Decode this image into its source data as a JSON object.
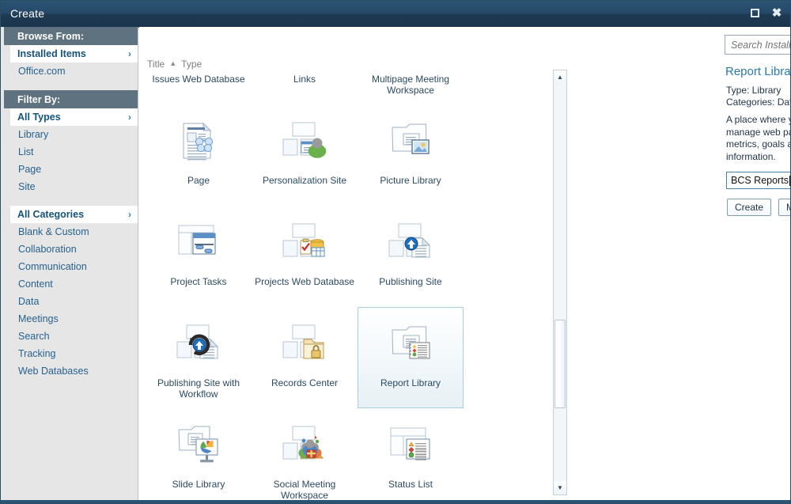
{
  "window": {
    "title": "Create",
    "maximize_label": "Restore",
    "close_label": "Close"
  },
  "sidebar": {
    "browse_from_header": "Browse From:",
    "browse_items": [
      {
        "label": "Installed Items",
        "selected": true,
        "chevron": "›"
      },
      {
        "label": "Office.com",
        "selected": false
      }
    ],
    "filter_by_header": "Filter By:",
    "type_items": [
      {
        "label": "All Types",
        "selected": true,
        "chevron": "›"
      },
      {
        "label": "Library",
        "selected": false
      },
      {
        "label": "List",
        "selected": false
      },
      {
        "label": "Page",
        "selected": false
      },
      {
        "label": "Site",
        "selected": false
      }
    ],
    "category_items": [
      {
        "label": "All Categories",
        "selected": true,
        "chevron": "›"
      },
      {
        "label": "Blank & Custom",
        "selected": false
      },
      {
        "label": "Collaboration",
        "selected": false
      },
      {
        "label": "Communication",
        "selected": false
      },
      {
        "label": "Content",
        "selected": false
      },
      {
        "label": "Data",
        "selected": false
      },
      {
        "label": "Meetings",
        "selected": false
      },
      {
        "label": "Search",
        "selected": false
      },
      {
        "label": "Tracking",
        "selected": false
      },
      {
        "label": "Web Databases",
        "selected": false
      }
    ]
  },
  "sortbar": {
    "title_label": "Title",
    "ascending_glyph": "▲",
    "type_label": "Type"
  },
  "gallery": {
    "tiles": [
      {
        "label": "Issues Web Database",
        "icon": "issues-web-database-icon",
        "selected": false
      },
      {
        "label": "Links",
        "icon": "links-icon",
        "selected": false
      },
      {
        "label": "Multipage Meeting Workspace",
        "icon": "multipage-meeting-workspace-icon",
        "selected": false
      },
      {
        "label": "Page",
        "icon": "page-icon",
        "selected": false
      },
      {
        "label": "Personalization Site",
        "icon": "personalization-site-icon",
        "selected": false
      },
      {
        "label": "Picture Library",
        "icon": "picture-library-icon",
        "selected": false
      },
      {
        "label": "Project Tasks",
        "icon": "project-tasks-icon",
        "selected": false
      },
      {
        "label": "Projects Web Database",
        "icon": "projects-web-database-icon",
        "selected": false
      },
      {
        "label": "Publishing Site",
        "icon": "publishing-site-icon",
        "selected": false
      },
      {
        "label": "Publishing Site with Workflow",
        "icon": "publishing-site-with-workflow-icon",
        "selected": false
      },
      {
        "label": "Records Center",
        "icon": "records-center-icon",
        "selected": false
      },
      {
        "label": "Report Library",
        "icon": "report-library-icon",
        "selected": true
      },
      {
        "label": "Slide Library",
        "icon": "slide-library-icon",
        "selected": false
      },
      {
        "label": "Social Meeting Workspace",
        "icon": "social-meeting-workspace-icon",
        "selected": false
      },
      {
        "label": "Status List",
        "icon": "status-list-icon",
        "selected": false
      }
    ]
  },
  "scrollbar": {
    "up_glyph": "▲",
    "down_glyph": "▼"
  },
  "search": {
    "placeholder": "Search Installed Items",
    "value": "",
    "icon": "search-icon"
  },
  "details": {
    "title": "Report Library",
    "type_line": "Type: Library",
    "categories_line": "Categories: Data",
    "description": "A place where you can easily create and manage web pages and documents to track metrics, goals and business intelligence information.",
    "name_value": "BCS Reports",
    "create_label": "Create",
    "more_options_label": "More Options"
  },
  "colors": {
    "titlebar": "#1e3a52",
    "sidebar_bg": "#e6e6e6",
    "sidebar_header": "#5e727f",
    "link_blue": "#29618e",
    "accent_blue": "#2879b0",
    "selection_border": "#a9cfdf"
  }
}
